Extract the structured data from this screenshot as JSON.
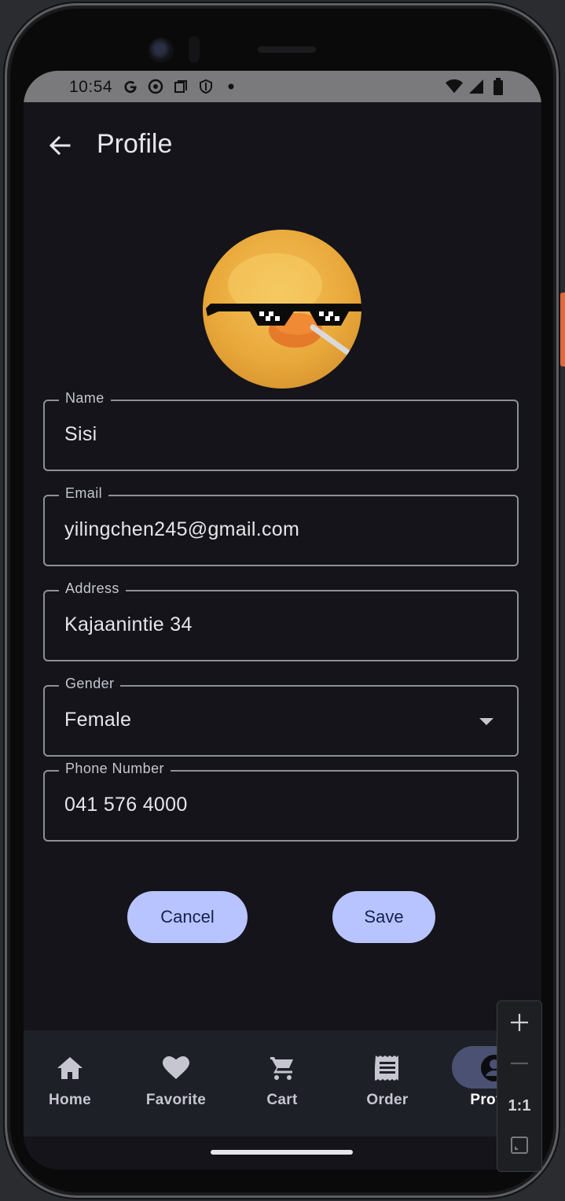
{
  "status_bar": {
    "time": "10:54",
    "left_icons": [
      "google-icon",
      "chrome-icon",
      "screenshot-icon",
      "shield-icon",
      "notification-dot-icon"
    ],
    "right_icons": [
      "wifi-icon",
      "signal-icon",
      "battery-icon"
    ]
  },
  "app_bar": {
    "title": "Profile",
    "back_icon": "arrow-back-icon"
  },
  "form": {
    "name": {
      "label": "Name",
      "value": "Sisi"
    },
    "email": {
      "label": "Email",
      "value": "yilingchen245@gmail.com"
    },
    "address": {
      "label": "Address",
      "value": "Kajaanintie 34"
    },
    "gender": {
      "label": "Gender",
      "value": "Female"
    },
    "phone": {
      "label": "Phone Number",
      "value": "041 576 4000"
    }
  },
  "buttons": {
    "cancel": "Cancel",
    "save": "Save"
  },
  "bottom_nav": {
    "items": [
      {
        "label": "Home",
        "icon": "home-icon"
      },
      {
        "label": "Favorite",
        "icon": "heart-icon"
      },
      {
        "label": "Cart",
        "icon": "cart-icon"
      },
      {
        "label": "Order",
        "icon": "receipt-icon"
      },
      {
        "label": "Profile",
        "icon": "profile-icon",
        "selected": true
      }
    ]
  },
  "zoom_controls": {
    "reset_label": "1:1"
  },
  "colors": {
    "background": "#14141a",
    "button": "#b8c4ff",
    "nav_bar": "#1e2028",
    "nav_selected_pill": "#4b5172"
  }
}
